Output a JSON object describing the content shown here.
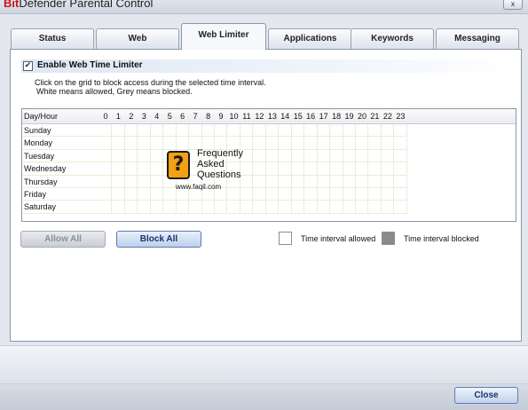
{
  "window": {
    "title_brand": "Bit",
    "title_rest": "Defender Parental Control",
    "close_glyph": "x"
  },
  "tabs": [
    {
      "label": "Status",
      "active": false
    },
    {
      "label": "Web",
      "active": false
    },
    {
      "label": "Web Limiter",
      "active": true
    },
    {
      "label": "Applications",
      "active": false
    },
    {
      "label": "Keywords",
      "active": false
    },
    {
      "label": "Messaging",
      "active": false
    }
  ],
  "limiter": {
    "enable_label": "Enable Web Time Limiter",
    "enabled": true,
    "instruction_1": "Click on the grid to block access during the selected time interval.",
    "instruction_2": "White means allowed, Grey means blocked."
  },
  "grid": {
    "corner_label": "Day/Hour",
    "hours": [
      "0",
      "1",
      "2",
      "3",
      "4",
      "5",
      "6",
      "7",
      "8",
      "9",
      "10",
      "11",
      "12",
      "13",
      "14",
      "15",
      "16",
      "17",
      "18",
      "19",
      "20",
      "21",
      "22",
      "23"
    ],
    "days": [
      "Sunday",
      "Monday",
      "Tuesday",
      "Wednesday",
      "Thursday",
      "Friday",
      "Saturday"
    ],
    "blocked_cells": []
  },
  "watermark": {
    "icon_glyph": "?",
    "line_1": "Frequently",
    "line_2": "Asked",
    "line_3": "Questions",
    "url": "www.faqil.com"
  },
  "buttons": {
    "allow_all": "Allow All",
    "block_all": "Block All",
    "close": "Close"
  },
  "legend": {
    "allowed_label": "Time interval allowed",
    "blocked_label": "Time interval blocked",
    "allowed_color": "#ffffff",
    "blocked_color": "#8a8a8a"
  }
}
